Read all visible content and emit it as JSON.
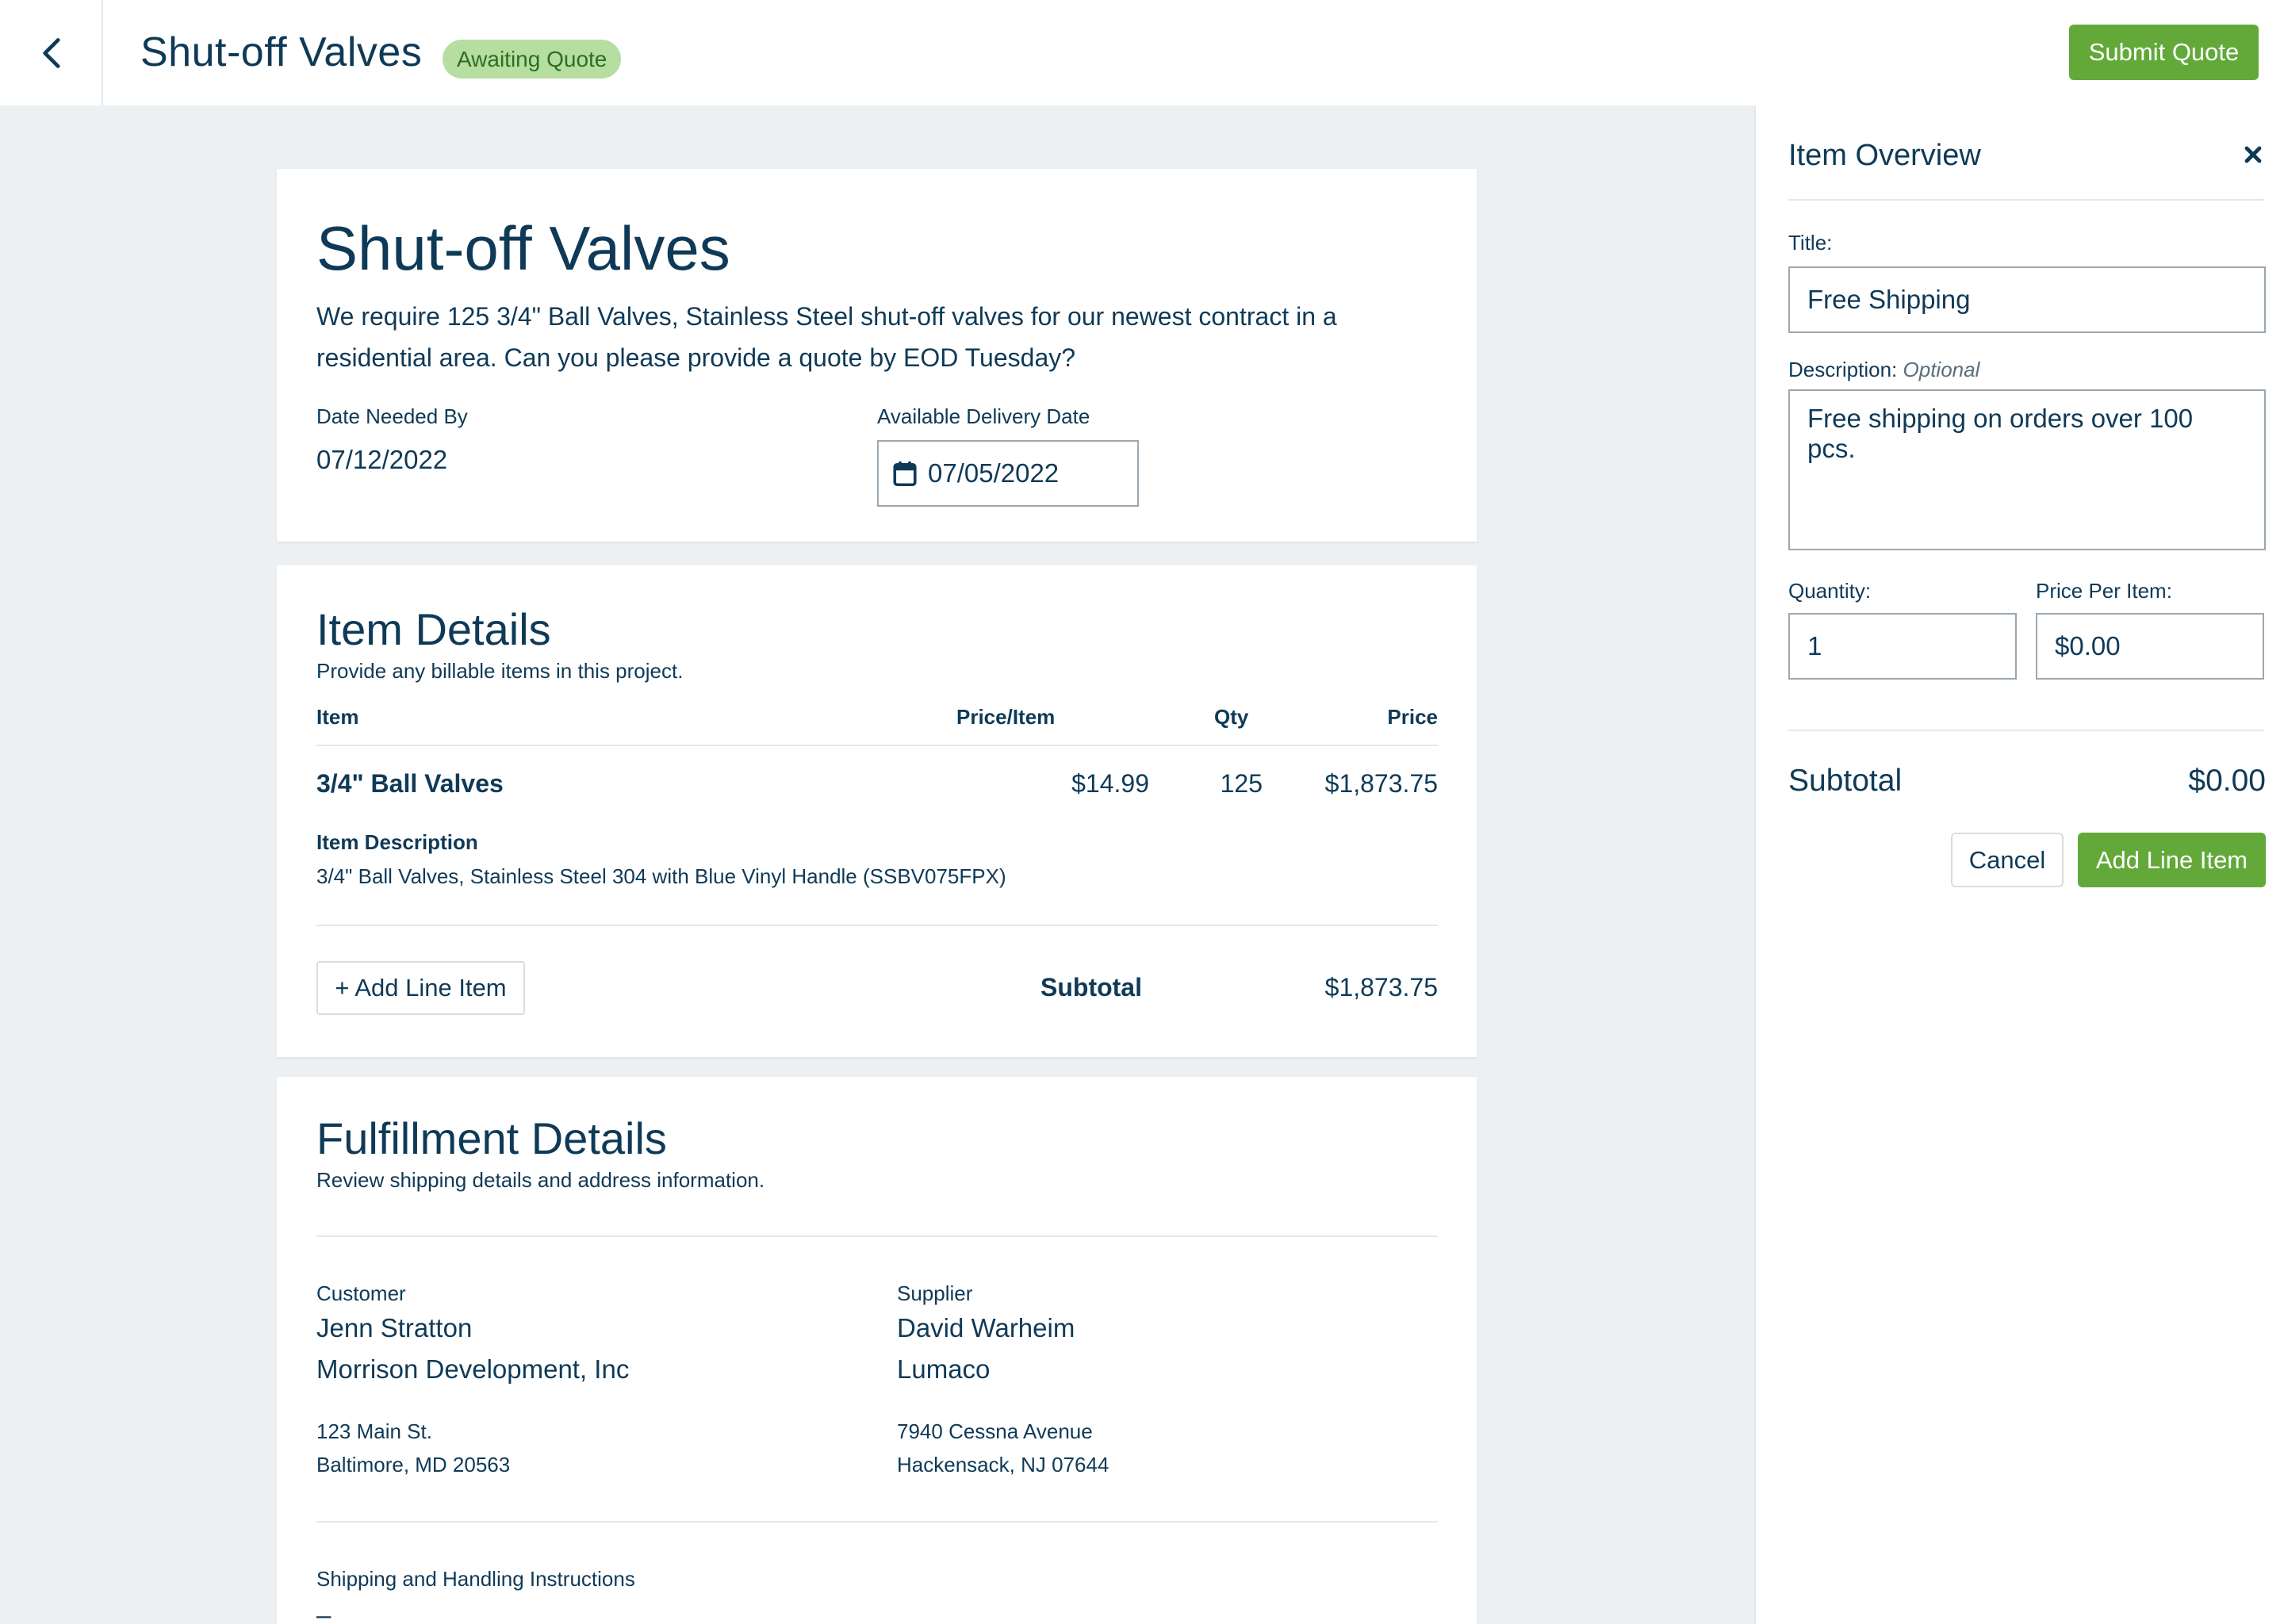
{
  "header": {
    "title": "Shut-off Valves",
    "status": "Awaiting Quote",
    "submit_label": "Submit Quote"
  },
  "request": {
    "title": "Shut-off Valves",
    "description": "We require 125 3/4\" Ball Valves,  Stainless Steel shut-off valves for our newest contract in a residential area. Can you please provide a quote by EOD Tuesday?",
    "date_needed_label": "Date Needed By",
    "date_needed": "07/12/2022",
    "delivery_label": "Available Delivery Date",
    "delivery_date": "07/05/2022"
  },
  "items": {
    "title": "Item Details",
    "subtitle": "Provide any billable items in this project.",
    "columns": {
      "item": "Item",
      "price_item": "Price/Item",
      "qty": "Qty",
      "price": "Price"
    },
    "rows": [
      {
        "name": "3/4\" Ball Valves",
        "price_item": "$14.99",
        "qty": "125",
        "price": "$1,873.75",
        "desc_label": "Item Description",
        "desc": "3/4\" Ball Valves, Stainless Steel 304 with Blue Vinyl Handle (SSBV075FPX)"
      }
    ],
    "add_label": "+ Add Line Item",
    "subtotal_label": "Subtotal",
    "subtotal": "$1,873.75"
  },
  "fulfillment": {
    "title": "Fulfillment Details",
    "subtitle": "Review shipping details and address information.",
    "customer": {
      "label": "Customer",
      "name": "Jenn Stratton",
      "company": "Morrison Development, Inc",
      "address1": "123 Main St.",
      "address2": "Baltimore, MD 20563"
    },
    "supplier": {
      "label": "Supplier",
      "name": "David Warheim",
      "company": "Lumaco",
      "address1": "7940 Cessna Avenue",
      "address2": "Hackensack, NJ 07644"
    },
    "instructions_label": "Shipping and Handling Instructions",
    "instructions": "–"
  },
  "panel": {
    "title": "Item Overview",
    "title_label": "Title:",
    "title_value": "Free Shipping",
    "desc_label": "Description:",
    "desc_optional": "Optional",
    "desc_value": "Free shipping on orders over 100 pcs.",
    "qty_label": "Quantity:",
    "qty_value": "1",
    "ppi_label": "Price Per Item:",
    "ppi_value": "$0.00",
    "subtotal_label": "Subtotal",
    "subtotal_value": "$0.00",
    "cancel_label": "Cancel",
    "add_label": "Add Line Item"
  },
  "icons": {
    "back": "chevron-left-icon",
    "calendar": "calendar-icon",
    "close": "close-icon"
  },
  "colors": {
    "primary_text": "#0f3a57",
    "accent_green": "#62a93a",
    "badge_bg": "#b6dea0",
    "background": "#ecf0f3"
  }
}
